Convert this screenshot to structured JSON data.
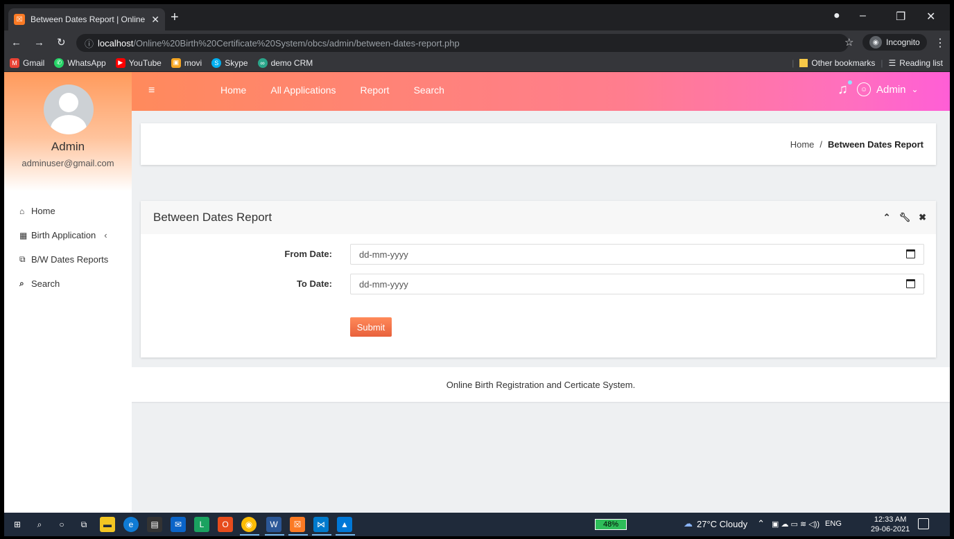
{
  "browser": {
    "tab_title": "Between Dates Report | Online B",
    "url_host": "localhost",
    "url_path": "/Online%20Birth%20Certificate%20System/obcs/admin/between-dates-report.php",
    "profile": "Incognito",
    "bookmarks": [
      "Gmail",
      "WhatsApp",
      "YouTube",
      "movi",
      "Skype",
      "demo CRM"
    ],
    "other_bookmarks": "Other bookmarks",
    "reading_list": "Reading list"
  },
  "sidebar": {
    "admin_name": "Admin",
    "admin_email": "adminuser@gmail.com",
    "items": [
      {
        "label": "Home",
        "icon": "home-icon"
      },
      {
        "label": "Birth Application",
        "icon": "table-icon"
      },
      {
        "label": "B/W Dates Reports",
        "icon": "copy-icon"
      },
      {
        "label": "Search",
        "icon": "search-icon"
      }
    ]
  },
  "topnav": {
    "links": [
      "Home",
      "All Applications",
      "Report",
      "Search"
    ],
    "user": "Admin"
  },
  "breadcrumb": {
    "home": "Home",
    "separator": "/",
    "current": "Between Dates Report"
  },
  "form": {
    "title": "Between Dates Report",
    "from_label": "From Date:",
    "to_label": "To Date:",
    "from_placeholder": "dd-mm-yyyy",
    "to_placeholder": "dd-mm-yyyy",
    "submit_label": "Submit"
  },
  "footer": {
    "text": "Online Birth Registration and Certicate System."
  },
  "taskbar": {
    "battery": "48%",
    "weather": "27°C Cloudy",
    "lang": "ENG",
    "time": "12:33 AM",
    "date": "29-06-2021"
  },
  "colors": {
    "nav_gradient_start": "#ff8a5c",
    "nav_gradient_end": "#ff5ed6",
    "submit": "#e8613c"
  }
}
